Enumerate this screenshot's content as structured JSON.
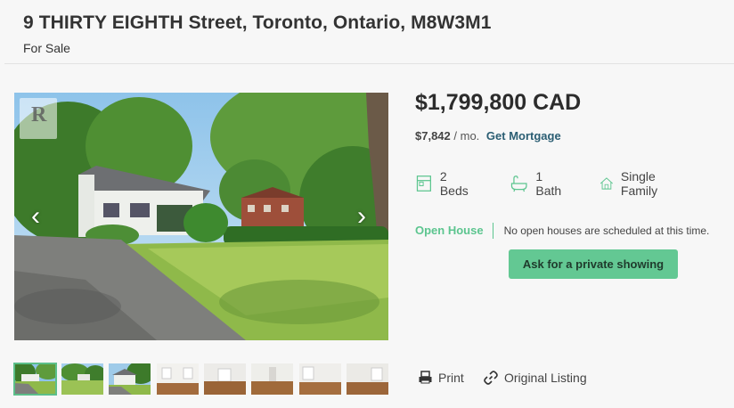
{
  "listing": {
    "address": "9 THIRTY EIGHTH Street, Toronto, Ontario, M8W3M1",
    "status": "For Sale"
  },
  "gallery": {
    "prev_icon": "chevron-left-icon",
    "next_icon": "chevron-right-icon",
    "prev_glyph": "‹",
    "next_glyph": "›",
    "logo_letter": "R",
    "thumbnails": [
      "exterior-front",
      "exterior-yard",
      "exterior-side",
      "interior-living",
      "interior-room",
      "interior-room",
      "interior-room",
      "interior-room"
    ]
  },
  "pricing": {
    "price": "$1,799,800 CAD",
    "monthly": "$7,842",
    "per_month": "/ mo.",
    "mortgage_link": "Get Mortgage"
  },
  "features": {
    "beds": "2 Beds",
    "baths": "1 Bath",
    "type": "Single Family"
  },
  "open_house": {
    "label": "Open House",
    "message": "No open houses are scheduled at this time."
  },
  "cta": {
    "showing_label": "Ask for a private showing"
  },
  "actions": {
    "print": "Print",
    "original": "Original Listing"
  },
  "colors": {
    "accent_green": "#63c893",
    "link_blue": "#2b5e73",
    "open_house_green": "#5cc58f"
  }
}
